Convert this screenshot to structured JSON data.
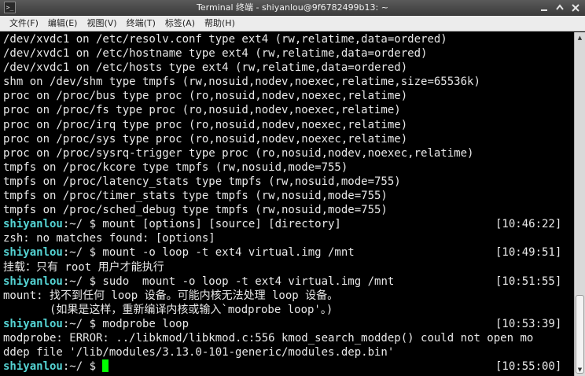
{
  "window": {
    "title": "Terminal 终端 - shiyanlou@9f6782499b13: ~",
    "icon": "terminal-icon",
    "controls": [
      "minimize-icon",
      "maximize-icon",
      "close-icon"
    ]
  },
  "menu": {
    "items": [
      "文件(F)",
      "编辑(E)",
      "视图(V)",
      "终端(T)",
      "标签(A)",
      "帮助(H)"
    ]
  },
  "terminal": {
    "lines": [
      {
        "text": "/dev/xvdc1 on /etc/resolv.conf type ext4 (rw,relatime,data=ordered)"
      },
      {
        "text": "/dev/xvdc1 on /etc/hostname type ext4 (rw,relatime,data=ordered)"
      },
      {
        "text": "/dev/xvdc1 on /etc/hosts type ext4 (rw,relatime,data=ordered)"
      },
      {
        "text": "shm on /dev/shm type tmpfs (rw,nosuid,nodev,noexec,relatime,size=65536k)"
      },
      {
        "text": "proc on /proc/bus type proc (ro,nosuid,nodev,noexec,relatime)"
      },
      {
        "text": "proc on /proc/fs type proc (ro,nosuid,nodev,noexec,relatime)"
      },
      {
        "text": "proc on /proc/irq type proc (ro,nosuid,nodev,noexec,relatime)"
      },
      {
        "text": "proc on /proc/sys type proc (ro,nosuid,nodev,noexec,relatime)"
      },
      {
        "text": "proc on /proc/sysrq-trigger type proc (ro,nosuid,nodev,noexec,relatime)"
      },
      {
        "text": "tmpfs on /proc/kcore type tmpfs (rw,nosuid,mode=755)"
      },
      {
        "text": "tmpfs on /proc/latency_stats type tmpfs (rw,nosuid,mode=755)"
      },
      {
        "text": "tmpfs on /proc/timer_stats type tmpfs (rw,nosuid,mode=755)"
      },
      {
        "text": "tmpfs on /proc/sched_debug type tmpfs (rw,nosuid,mode=755)"
      },
      {
        "user": "shiyanlou",
        "rest": ":~/ $ mount [options] [source] [directory]",
        "time": "[10:46:22]"
      },
      {
        "text": "zsh: no matches found: [options]"
      },
      {
        "user": "shiyanlou",
        "rest": ":~/ $ mount -o loop -t ext4 virtual.img /mnt",
        "time": "[10:49:51]"
      },
      {
        "text": "挂载：只有 root 用户才能执行"
      },
      {
        "user": "shiyanlou",
        "rest": ":~/ $ sudo  mount -o loop -t ext4 virtual.img /mnt",
        "time": "[10:51:55]"
      },
      {
        "text": "mount: 找不到任何 loop 设备。可能内核无法处理 loop 设备。"
      },
      {
        "text": "       (如果是这样，重新编译内核或输入`modprobe loop'。)"
      },
      {
        "user": "shiyanlou",
        "rest": ":~/ $ modprobe loop",
        "time": "[10:53:39]"
      },
      {
        "text": "modprobe: ERROR: ../libkmod/libkmod.c:556 kmod_search_moddep() could not open mo"
      },
      {
        "text": "ddep file '/lib/modules/3.13.0-101-generic/modules.dep.bin'"
      },
      {
        "user": "shiyanlou",
        "rest": ":~/ $ ",
        "time": "[10:55:00]",
        "cursor": true
      }
    ]
  },
  "colors": {
    "background": "#000000",
    "foreground": "#e8e8e8",
    "prompt_user": "#55d4d4",
    "cursor": "#00ff00"
  }
}
